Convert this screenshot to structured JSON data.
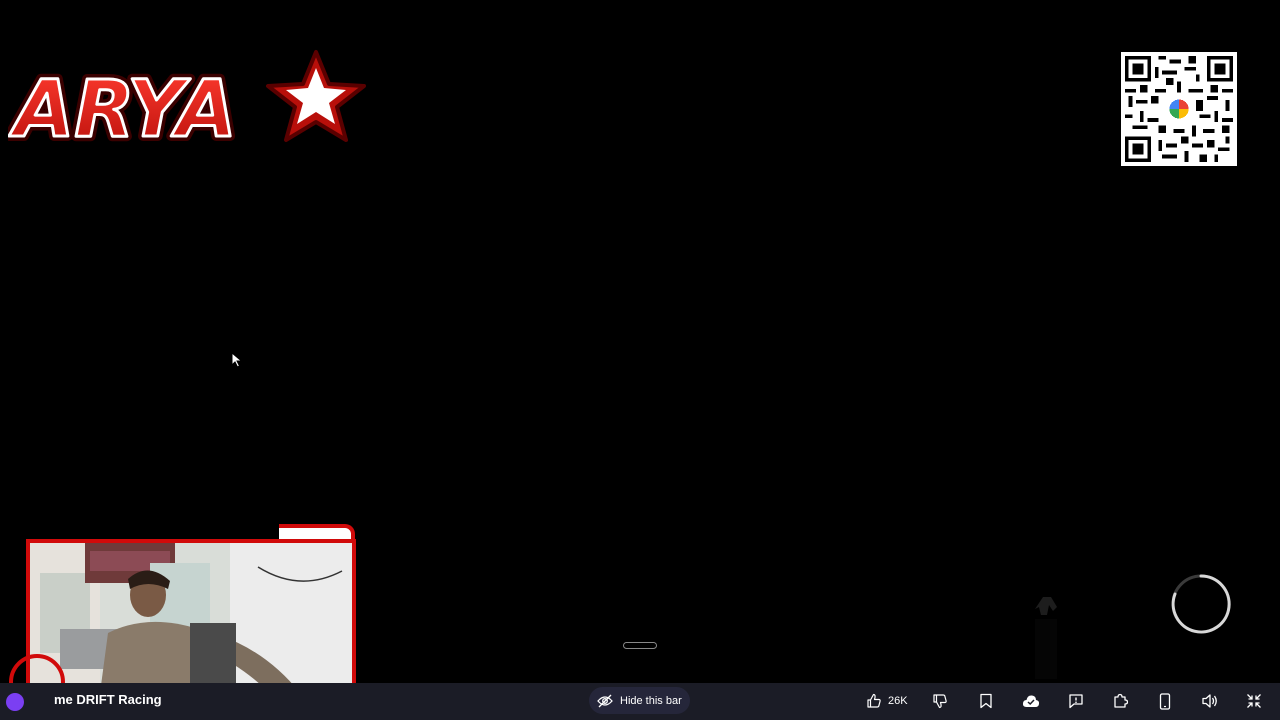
{
  "logo": {
    "text": "ARYA"
  },
  "game": {
    "title": "me DRIFT Racing"
  },
  "bottom_bar": {
    "hide_bar_label": "Hide this bar",
    "like_count": "26K"
  },
  "icons": {
    "logo_star": "star-icon",
    "hide": "eye-slash-icon",
    "like": "thumbs-up-icon",
    "dislike": "thumbs-down-icon",
    "save": "bookmark-icon",
    "cloud_save": "cloud-check-icon",
    "report": "report-flag-icon",
    "extensions": "puzzle-icon",
    "mobile": "phone-icon",
    "audio": "speaker-icon",
    "fullscreen": "exit-fullscreen-icon",
    "loading": "spinner-icon"
  },
  "colors": {
    "background": "#000000",
    "bar": "#1b1c26",
    "logo_red": "#e2231a",
    "webcam_border": "#d10a0a",
    "badge": "#7b3ff2"
  }
}
